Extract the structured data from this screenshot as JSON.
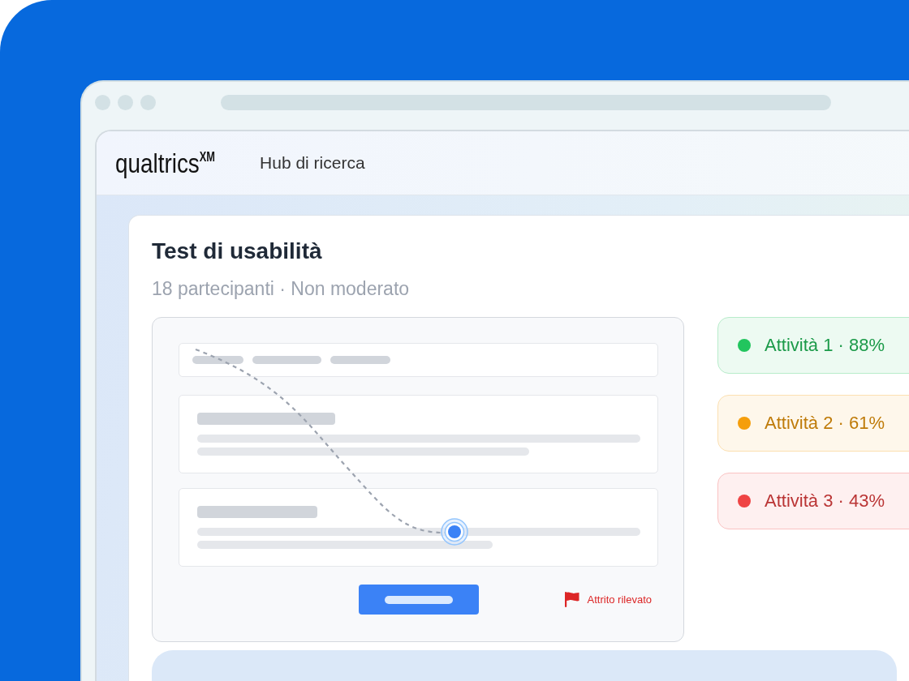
{
  "header": {
    "logo": "qualtrics$^{XM}$",
    "section": "Hub di ricerca"
  },
  "study": {
    "title": "Test di usabilità",
    "meta": "18 partecipanti · Non moderato"
  },
  "prototype": {
    "friction_label": "Attrito rilevato"
  },
  "tasks": [
    {
      "label": "Attività 1 · 88%",
      "color": "#22c55e"
    },
    {
      "label": "Attività 2 · 61%",
      "color": "#f59e0b"
    },
    {
      "label": "Attività 3 · 43%",
      "color": "#ef4444"
    }
  ]
}
